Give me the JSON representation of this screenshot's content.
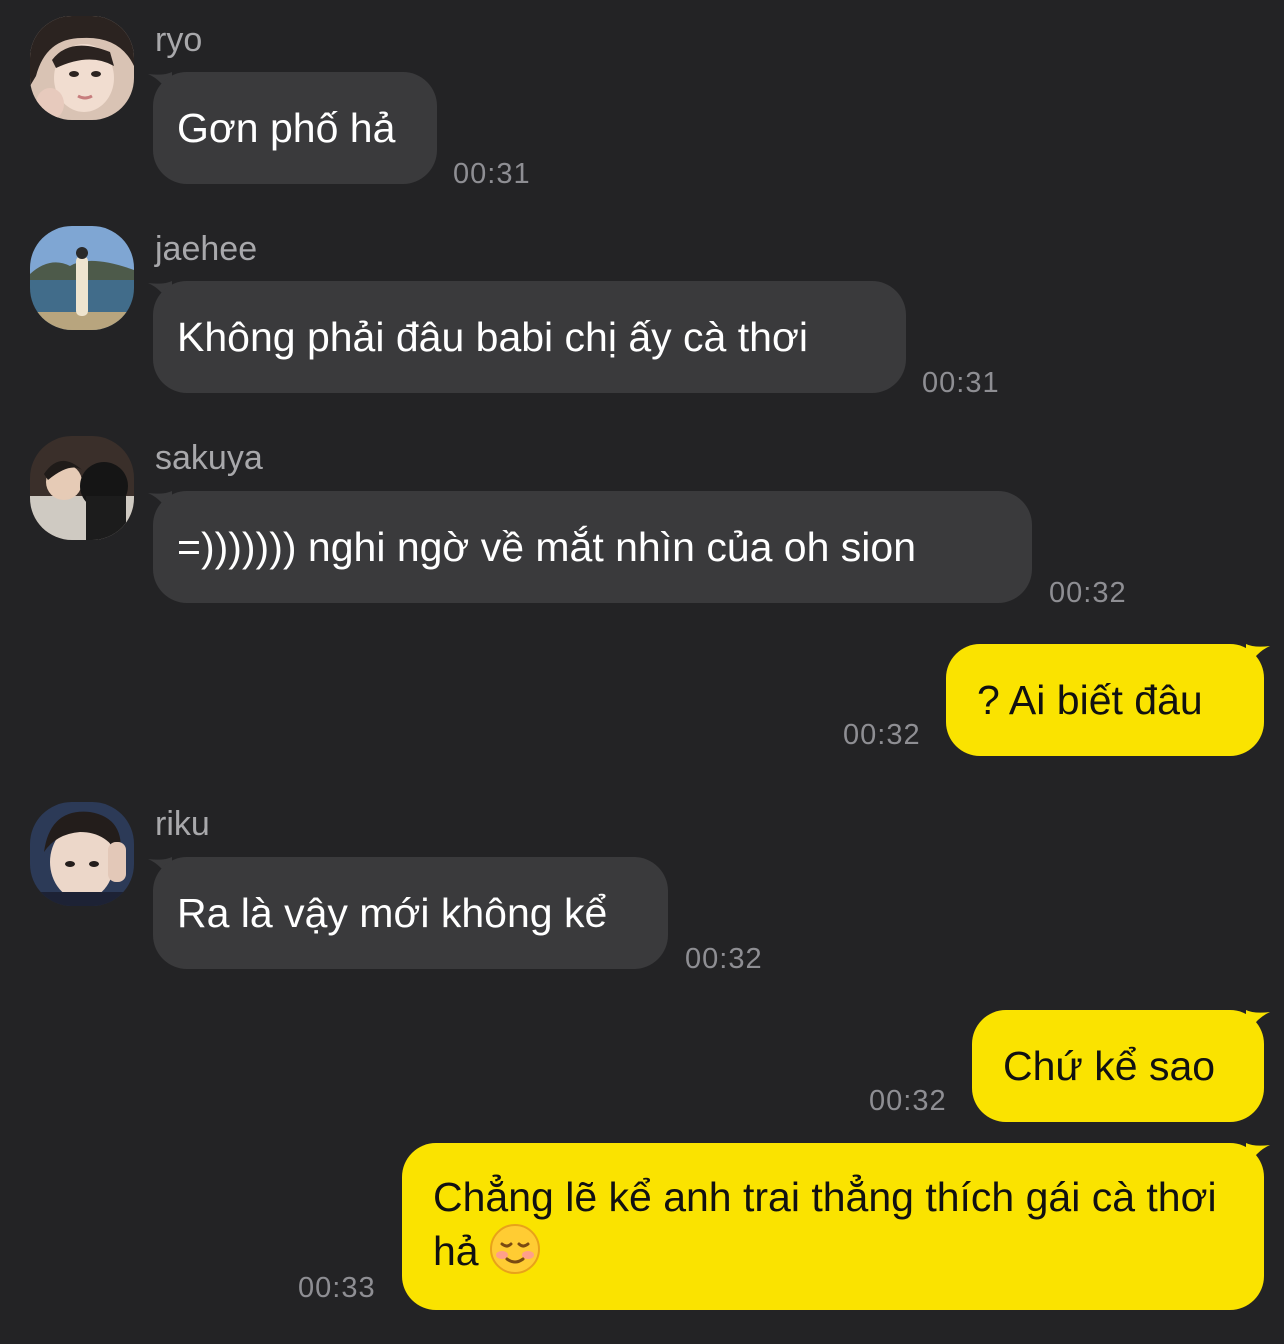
{
  "messages": [
    {
      "sender": "ryo",
      "text": "Gơn phố hả",
      "time": "00:31",
      "avatar_icon": "avatar-ryo-icon"
    },
    {
      "sender": "jaehee",
      "text": "Không phải đâu babi chị ấy cà thơi",
      "time": "00:31",
      "avatar_icon": "avatar-jaehee-icon"
    },
    {
      "sender": "sakuya",
      "text": "=))))))) nghi ngờ về mắt nhìn của oh sion",
      "time": "00:32",
      "avatar_icon": "avatar-sakuya-icon"
    },
    {
      "sender": "",
      "text": "? Ai biết đâu",
      "time": "00:32",
      "outgoing": true
    },
    {
      "sender": "riku",
      "text": "Ra là vậy mới không kể",
      "time": "00:32",
      "avatar_icon": "avatar-riku-icon"
    },
    {
      "sender": "",
      "text": "Chứ kể sao",
      "time": "00:32",
      "outgoing": true
    },
    {
      "sender": "",
      "text": "Chẳng lẽ kể anh trai thẳng thích gái cà thơi hả",
      "emoji": "smiling-face-emoji",
      "time": "00:33",
      "outgoing": true
    }
  ],
  "colors": {
    "background": "#232325",
    "incoming_bubble": "#3a3a3c",
    "outgoing_bubble": "#fae300",
    "timestamp": "#8e8e93",
    "sender_name": "#a8a8ab"
  }
}
